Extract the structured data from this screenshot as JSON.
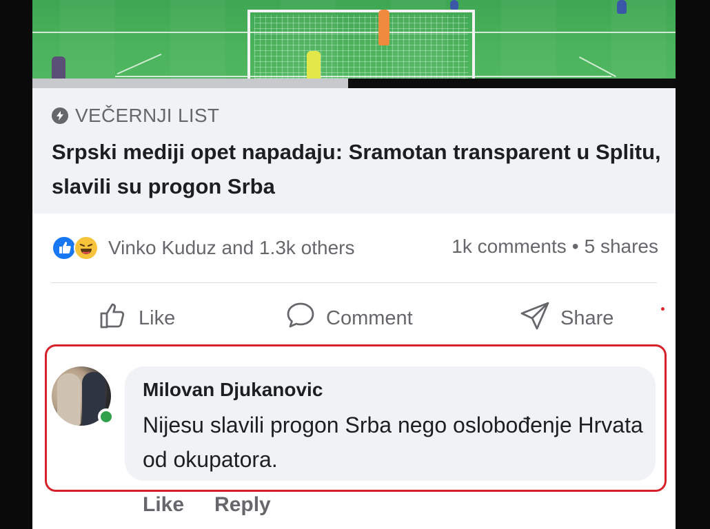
{
  "link_card": {
    "source": "VEČERNJI LIST",
    "headline": "Srpski mediji opet napadaju: Sramotan transparent u Splitu, slavili su progon Srba"
  },
  "reactions": {
    "icons": [
      "like-reaction",
      "haha-reaction"
    ],
    "names": "Vinko Kuduz and 1.3k others",
    "comments": "1k comments",
    "separator": "•",
    "shares": "5 shares"
  },
  "actions": {
    "like": "Like",
    "comment": "Comment",
    "share": "Share"
  },
  "comment": {
    "author": "Milovan Djukanovic",
    "text": "Nijesu slavili progon Srba nego oslobođenje Hrvata od okupatora.",
    "online": true,
    "like_label": "Like",
    "reply_label": "Reply"
  },
  "colors": {
    "highlight_border": "#d8202a",
    "facebook_blue": "#1877f2",
    "online_green": "#31a24c",
    "secondary_text": "#65676b"
  }
}
